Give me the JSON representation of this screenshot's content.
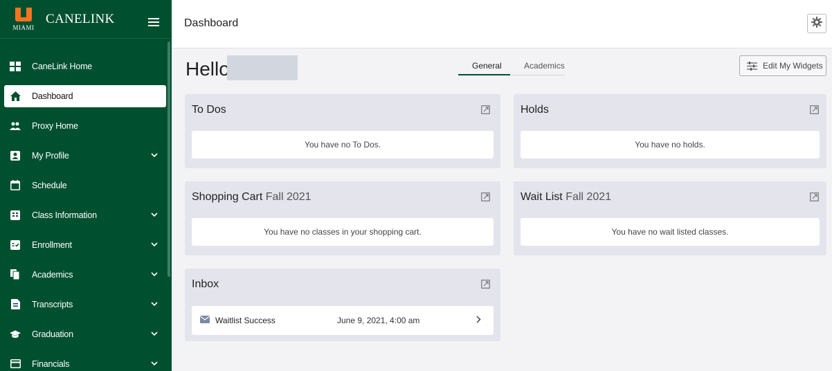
{
  "app": {
    "brand_name": "CANELINK",
    "logo_text": "MIAMI"
  },
  "sidebar": {
    "items": [
      {
        "label": "CaneLink Home",
        "icon": "home-grid-icon",
        "expandable": false
      },
      {
        "label": "Dashboard",
        "icon": "house-icon",
        "expandable": false,
        "active": true
      },
      {
        "label": "Proxy Home",
        "icon": "people-icon",
        "expandable": false
      },
      {
        "label": "My Profile",
        "icon": "profile-card-icon",
        "expandable": true
      },
      {
        "label": "Schedule",
        "icon": "calendar-icon",
        "expandable": false
      },
      {
        "label": "Class Information",
        "icon": "class-info-icon",
        "expandable": true
      },
      {
        "label": "Enrollment",
        "icon": "enrollment-icon",
        "expandable": true
      },
      {
        "label": "Academics",
        "icon": "documents-icon",
        "expandable": true
      },
      {
        "label": "Transcripts",
        "icon": "transcript-icon",
        "expandable": true
      },
      {
        "label": "Graduation",
        "icon": "graduation-cap-icon",
        "expandable": true
      },
      {
        "label": "Financials",
        "icon": "wallet-icon",
        "expandable": true
      }
    ]
  },
  "topbar": {
    "title": "Dashboard"
  },
  "main": {
    "greeting": "Hello",
    "tabs": [
      {
        "label": "General",
        "active": true
      },
      {
        "label": "Academics",
        "active": false
      }
    ],
    "edit_widgets_label": "Edit My Widgets"
  },
  "widgets": {
    "todos": {
      "title": "To Dos",
      "message": "You have no To Dos."
    },
    "holds": {
      "title": "Holds",
      "message": "You have no holds."
    },
    "shopping_cart": {
      "title": "Shopping Cart",
      "term": "Fall 2021",
      "message": "You have no classes in your shopping cart."
    },
    "wait_list": {
      "title": "Wait List",
      "term": "Fall 2021",
      "message": "You have no wait listed classes."
    },
    "inbox": {
      "title": "Inbox",
      "messages": [
        {
          "subject": "Waitlist Success",
          "date": "June 9, 2021, 4:00 am"
        }
      ]
    }
  },
  "colors": {
    "sidebar_green": "#005030",
    "brand_orange": "#f47321",
    "card_bg": "#e3e4ec",
    "page_bg": "#f3f3f6"
  }
}
